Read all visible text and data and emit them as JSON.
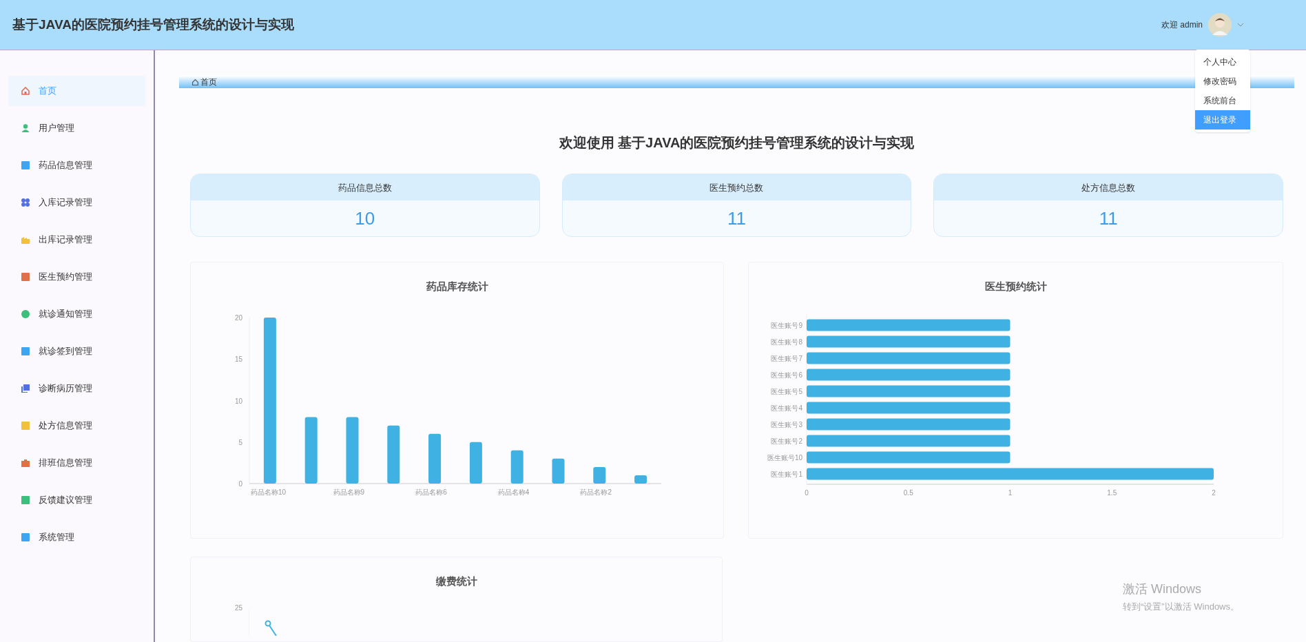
{
  "header": {
    "title": "基于JAVA的医院预约挂号管理系统的设计与实现",
    "greeting": "欢迎 admin"
  },
  "user_menu": [
    {
      "label": "个人中心",
      "selected": false
    },
    {
      "label": "修改密码",
      "selected": false
    },
    {
      "label": "系统前台",
      "selected": false
    },
    {
      "label": "退出登录",
      "selected": true
    }
  ],
  "sidebar": {
    "items": [
      {
        "label": "首页",
        "selected": true,
        "color": "#e06c5a"
      },
      {
        "label": "用户管理",
        "selected": false,
        "color": "#3cbf7c"
      },
      {
        "label": "药品信息管理",
        "selected": false,
        "color": "#3ea6f0"
      },
      {
        "label": "入库记录管理",
        "selected": false,
        "color": "#5470e0"
      },
      {
        "label": "出库记录管理",
        "selected": false,
        "color": "#f0c23c"
      },
      {
        "label": "医生预约管理",
        "selected": false,
        "color": "#e07048"
      },
      {
        "label": "就诊通知管理",
        "selected": false,
        "color": "#3cbf7c"
      },
      {
        "label": "就诊签到管理",
        "selected": false,
        "color": "#3ea6f0"
      },
      {
        "label": "诊断病历管理",
        "selected": false,
        "color": "#5470e0"
      },
      {
        "label": "处方信息管理",
        "selected": false,
        "color": "#f0c23c"
      },
      {
        "label": "排班信息管理",
        "selected": false,
        "color": "#e07048"
      },
      {
        "label": "反馈建议管理",
        "selected": false,
        "color": "#3cbf7c"
      },
      {
        "label": "系统管理",
        "selected": false,
        "color": "#3ea6f0"
      }
    ]
  },
  "breadcrumb": "首页",
  "welcome": "欢迎使用 基于JAVA的医院预约挂号管理系统的设计与实现",
  "stats": [
    {
      "label": "药品信息总数",
      "value": "10"
    },
    {
      "label": "医生预约总数",
      "value": "11"
    },
    {
      "label": "处方信息总数",
      "value": "11"
    }
  ],
  "charts": [
    {
      "chart_data": {
        "type": "bar",
        "title": "药品库存统计",
        "categories": [
          "药品名称10",
          null,
          "药品名称9",
          null,
          "药品名称6",
          null,
          "药品名称4",
          null,
          "药品名称2",
          null
        ],
        "series": [
          {
            "color": "#3fb1e3",
            "values": [
              20,
              8,
              8,
              7,
              6,
              5,
              4,
              3,
              2,
              1
            ]
          }
        ],
        "ylim": [
          0,
          20
        ],
        "yticks": [
          0,
          5,
          10,
          15,
          20
        ]
      }
    },
    {
      "chart_data": {
        "type": "bar",
        "orientation": "horizontal",
        "title": "医生预约统计",
        "categories": [
          "医生账号9",
          "医生账号8",
          "医生账号7",
          "医生账号6",
          "医生账号5",
          "医生账号4",
          "医生账号3",
          "医生账号2",
          "医生账号10",
          "医生账号1"
        ],
        "series": [
          {
            "color": "#3fb1e3",
            "values": [
              1,
              1,
              1,
              1,
              1,
              1,
              1,
              1,
              1,
              2
            ]
          }
        ],
        "xlim": [
          0,
          2
        ],
        "xticks": [
          0,
          0.5,
          1,
          1.5,
          2
        ]
      }
    }
  ],
  "payment_chart": {
    "title": "缴费统计",
    "top_tick": "25"
  },
  "os_notice": {
    "title": "激活 Windows",
    "text": "转到“设置”以激活 Windows。"
  }
}
